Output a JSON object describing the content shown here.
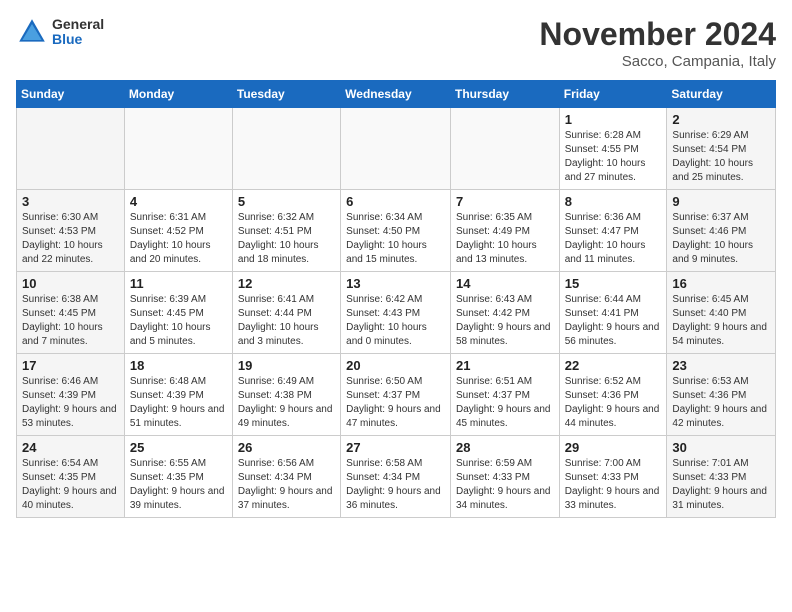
{
  "header": {
    "logo_general": "General",
    "logo_blue": "Blue",
    "month_title": "November 2024",
    "location": "Sacco, Campania, Italy"
  },
  "weekdays": [
    "Sunday",
    "Monday",
    "Tuesday",
    "Wednesday",
    "Thursday",
    "Friday",
    "Saturday"
  ],
  "weeks": [
    [
      {
        "day": "",
        "info": ""
      },
      {
        "day": "",
        "info": ""
      },
      {
        "day": "",
        "info": ""
      },
      {
        "day": "",
        "info": ""
      },
      {
        "day": "",
        "info": ""
      },
      {
        "day": "1",
        "info": "Sunrise: 6:28 AM\nSunset: 4:55 PM\nDaylight: 10 hours and 27 minutes."
      },
      {
        "day": "2",
        "info": "Sunrise: 6:29 AM\nSunset: 4:54 PM\nDaylight: 10 hours and 25 minutes."
      }
    ],
    [
      {
        "day": "3",
        "info": "Sunrise: 6:30 AM\nSunset: 4:53 PM\nDaylight: 10 hours and 22 minutes."
      },
      {
        "day": "4",
        "info": "Sunrise: 6:31 AM\nSunset: 4:52 PM\nDaylight: 10 hours and 20 minutes."
      },
      {
        "day": "5",
        "info": "Sunrise: 6:32 AM\nSunset: 4:51 PM\nDaylight: 10 hours and 18 minutes."
      },
      {
        "day": "6",
        "info": "Sunrise: 6:34 AM\nSunset: 4:50 PM\nDaylight: 10 hours and 15 minutes."
      },
      {
        "day": "7",
        "info": "Sunrise: 6:35 AM\nSunset: 4:49 PM\nDaylight: 10 hours and 13 minutes."
      },
      {
        "day": "8",
        "info": "Sunrise: 6:36 AM\nSunset: 4:47 PM\nDaylight: 10 hours and 11 minutes."
      },
      {
        "day": "9",
        "info": "Sunrise: 6:37 AM\nSunset: 4:46 PM\nDaylight: 10 hours and 9 minutes."
      }
    ],
    [
      {
        "day": "10",
        "info": "Sunrise: 6:38 AM\nSunset: 4:45 PM\nDaylight: 10 hours and 7 minutes."
      },
      {
        "day": "11",
        "info": "Sunrise: 6:39 AM\nSunset: 4:45 PM\nDaylight: 10 hours and 5 minutes."
      },
      {
        "day": "12",
        "info": "Sunrise: 6:41 AM\nSunset: 4:44 PM\nDaylight: 10 hours and 3 minutes."
      },
      {
        "day": "13",
        "info": "Sunrise: 6:42 AM\nSunset: 4:43 PM\nDaylight: 10 hours and 0 minutes."
      },
      {
        "day": "14",
        "info": "Sunrise: 6:43 AM\nSunset: 4:42 PM\nDaylight: 9 hours and 58 minutes."
      },
      {
        "day": "15",
        "info": "Sunrise: 6:44 AM\nSunset: 4:41 PM\nDaylight: 9 hours and 56 minutes."
      },
      {
        "day": "16",
        "info": "Sunrise: 6:45 AM\nSunset: 4:40 PM\nDaylight: 9 hours and 54 minutes."
      }
    ],
    [
      {
        "day": "17",
        "info": "Sunrise: 6:46 AM\nSunset: 4:39 PM\nDaylight: 9 hours and 53 minutes."
      },
      {
        "day": "18",
        "info": "Sunrise: 6:48 AM\nSunset: 4:39 PM\nDaylight: 9 hours and 51 minutes."
      },
      {
        "day": "19",
        "info": "Sunrise: 6:49 AM\nSunset: 4:38 PM\nDaylight: 9 hours and 49 minutes."
      },
      {
        "day": "20",
        "info": "Sunrise: 6:50 AM\nSunset: 4:37 PM\nDaylight: 9 hours and 47 minutes."
      },
      {
        "day": "21",
        "info": "Sunrise: 6:51 AM\nSunset: 4:37 PM\nDaylight: 9 hours and 45 minutes."
      },
      {
        "day": "22",
        "info": "Sunrise: 6:52 AM\nSunset: 4:36 PM\nDaylight: 9 hours and 44 minutes."
      },
      {
        "day": "23",
        "info": "Sunrise: 6:53 AM\nSunset: 4:36 PM\nDaylight: 9 hours and 42 minutes."
      }
    ],
    [
      {
        "day": "24",
        "info": "Sunrise: 6:54 AM\nSunset: 4:35 PM\nDaylight: 9 hours and 40 minutes."
      },
      {
        "day": "25",
        "info": "Sunrise: 6:55 AM\nSunset: 4:35 PM\nDaylight: 9 hours and 39 minutes."
      },
      {
        "day": "26",
        "info": "Sunrise: 6:56 AM\nSunset: 4:34 PM\nDaylight: 9 hours and 37 minutes."
      },
      {
        "day": "27",
        "info": "Sunrise: 6:58 AM\nSunset: 4:34 PM\nDaylight: 9 hours and 36 minutes."
      },
      {
        "day": "28",
        "info": "Sunrise: 6:59 AM\nSunset: 4:33 PM\nDaylight: 9 hours and 34 minutes."
      },
      {
        "day": "29",
        "info": "Sunrise: 7:00 AM\nSunset: 4:33 PM\nDaylight: 9 hours and 33 minutes."
      },
      {
        "day": "30",
        "info": "Sunrise: 7:01 AM\nSunset: 4:33 PM\nDaylight: 9 hours and 31 minutes."
      }
    ]
  ]
}
